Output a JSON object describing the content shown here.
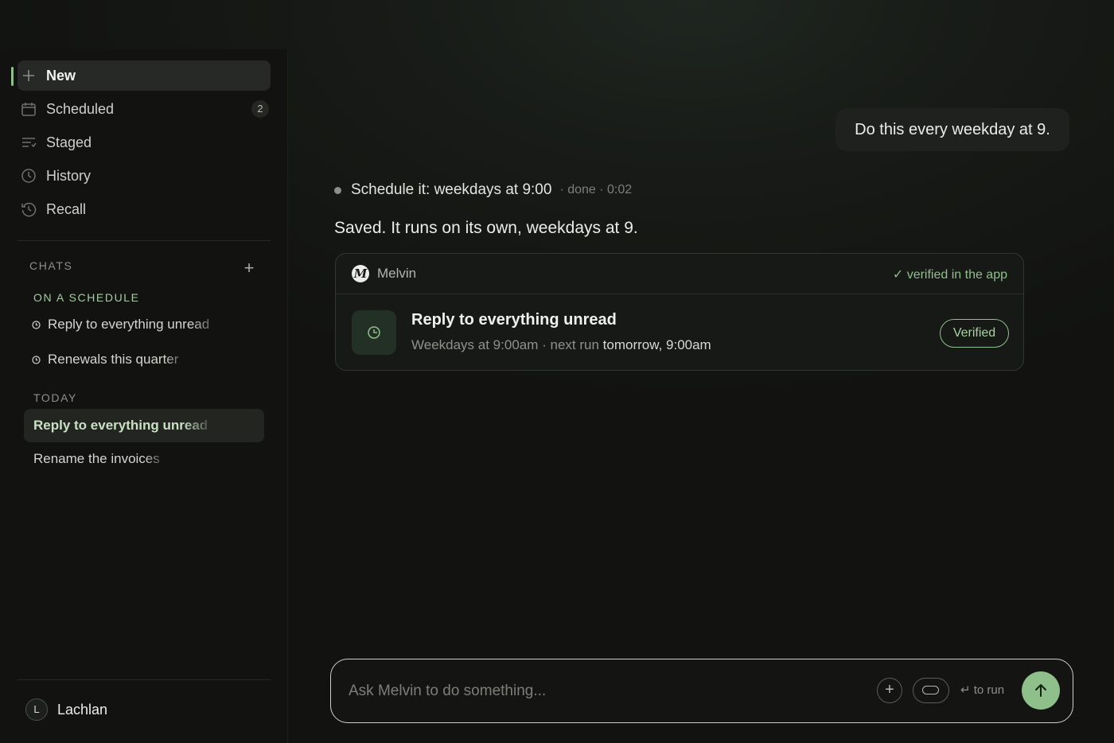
{
  "sidebar": {
    "nav": [
      {
        "label": "New",
        "icon": "plus-icon",
        "active": true
      },
      {
        "label": "Scheduled",
        "icon": "calendar-icon",
        "badge": "2"
      },
      {
        "label": "Staged",
        "icon": "staged-list-icon"
      },
      {
        "label": "History",
        "icon": "clock-icon"
      },
      {
        "label": "Recall",
        "icon": "history-rewind-icon"
      }
    ],
    "chats_heading": "CHATS",
    "chats_add": "+",
    "schedule_heading": "ON A SCHEDULE",
    "scheduled_chats": [
      {
        "label": "Reply to everything unread",
        "icon": "clock-icon"
      },
      {
        "label": "Renewals this quarter",
        "icon": "clock-icon"
      }
    ],
    "today_heading": "TODAY",
    "today_chats": [
      {
        "label": "Reply to everything unread",
        "active": true
      },
      {
        "label": "Rename the invoices"
      }
    ],
    "user": {
      "initial": "L",
      "name": "Lachlan"
    }
  },
  "conversation": {
    "user_message": "Do this every weekday at 9.",
    "step": {
      "text": "Schedule it: weekdays at 9:00",
      "meta": "· done · 0:02"
    },
    "reply": "Saved. It runs on its own, weekdays at 9.",
    "card": {
      "logo": "M",
      "brand": "Melvin",
      "verified_note": "✓ verified in the app",
      "task_title": "Reply to everything unread",
      "task_schedule": "Weekdays at 9:00am · next run",
      "task_next_run": "tomorrow, 9:00am",
      "status": "Verified"
    }
  },
  "composer": {
    "placeholder": "Ask Melvin to do something...",
    "value": "",
    "add_label": "+",
    "enter_hint": "↵ to run"
  },
  "colors": {
    "accent": "#8fbf8a",
    "background": "#121311"
  }
}
